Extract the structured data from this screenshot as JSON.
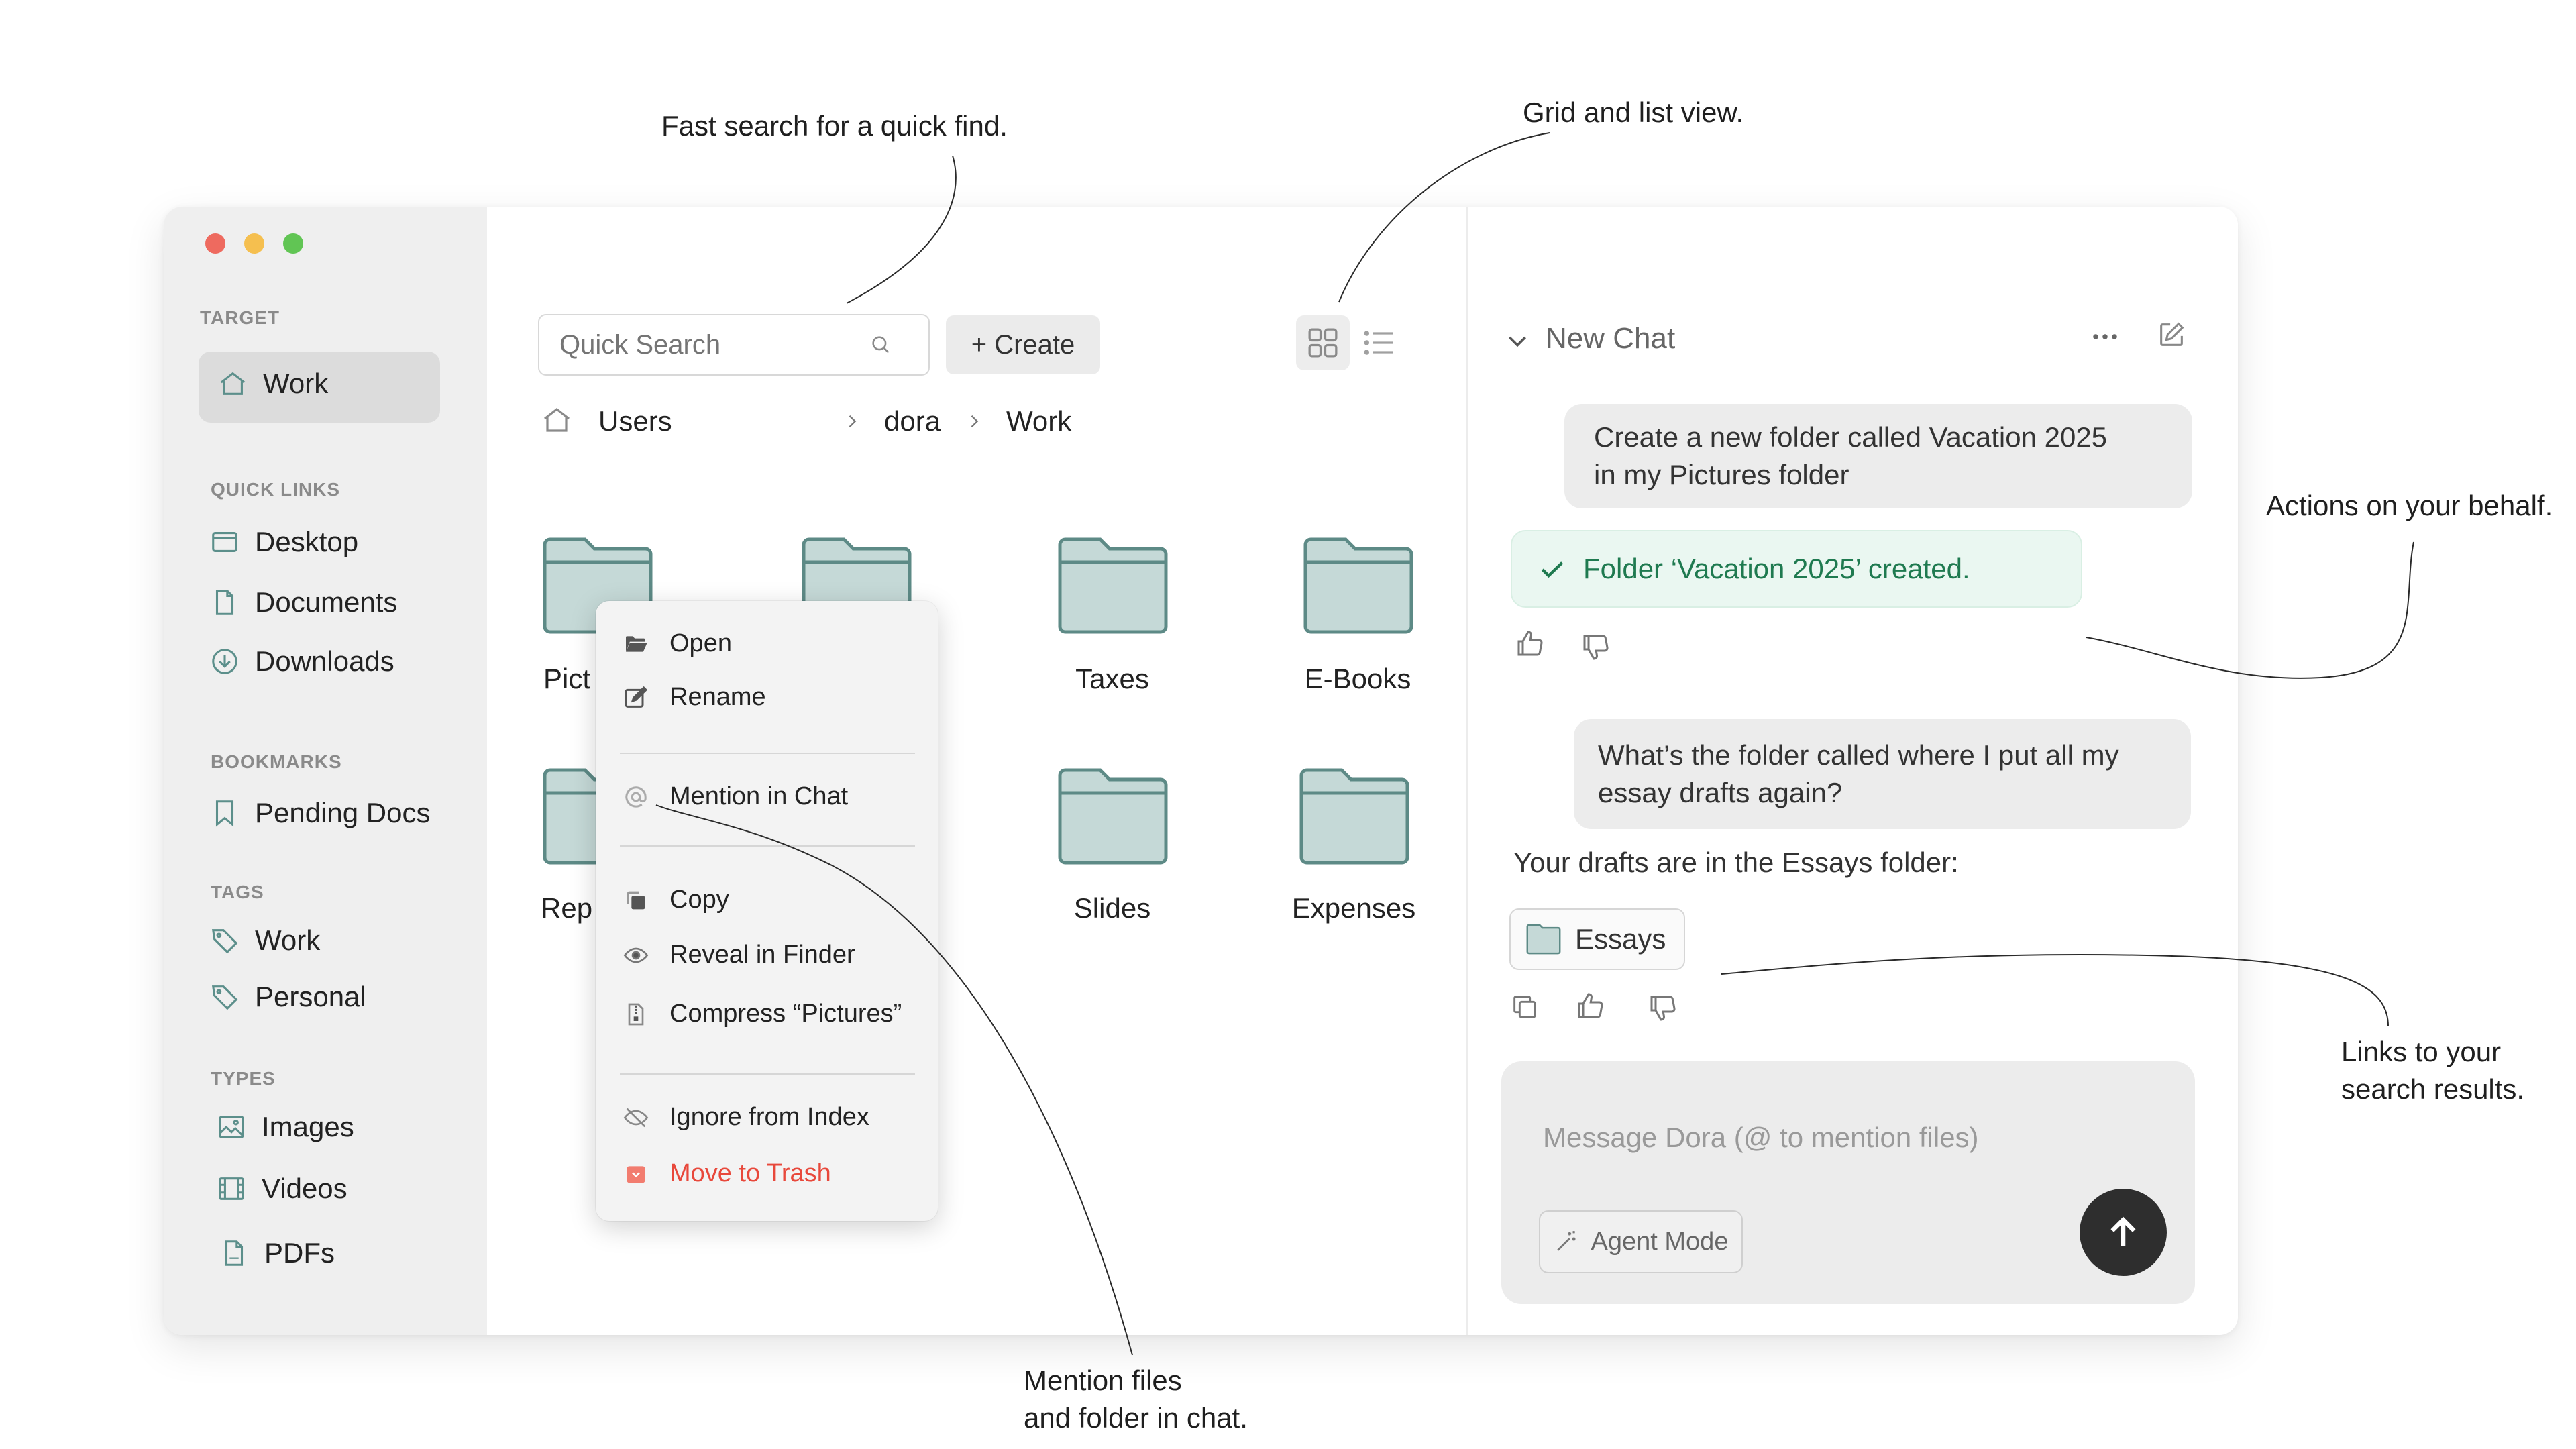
{
  "annotations": {
    "search": "Fast search for a quick find.",
    "view": "Grid and list view.",
    "actions": "Actions on your behalf.",
    "links_line1": "Links to your",
    "links_line2": "search results.",
    "mention_line1": "Mention files",
    "mention_line2": "and folder in chat."
  },
  "sidebar": {
    "target_label": "TARGET",
    "target_item": "Work",
    "quick_links_label": "QUICK LINKS",
    "quick_links": [
      "Desktop",
      "Documents",
      "Downloads"
    ],
    "bookmarks_label": "BOOKMARKS",
    "bookmarks": [
      "Pending Docs"
    ],
    "tags_label": "TAGS",
    "tags": [
      "Work",
      "Personal"
    ],
    "types_label": "TYPES",
    "types": [
      "Images",
      "Videos",
      "PDFs"
    ]
  },
  "toolbar": {
    "search_placeholder": "Quick Search",
    "create_label": "+ Create"
  },
  "breadcrumb": [
    "Users",
    "dora",
    "Work"
  ],
  "folders": [
    "Pict",
    "Taxes",
    "E-Books",
    "Rep",
    "Slides",
    "Expenses"
  ],
  "context_menu": {
    "open": "Open",
    "rename": "Rename",
    "mention": "Mention in Chat",
    "copy": "Copy",
    "reveal": "Reveal in Finder",
    "compress": "Compress “Pictures”",
    "ignore": "Ignore from Index",
    "trash": "Move to Trash"
  },
  "chat": {
    "title": "New Chat",
    "msg1_line1": "Create a new folder called Vacation 2025",
    "msg1_line2": "in my Pictures folder",
    "success": "Folder ‘Vacation 2025’ created.",
    "msg2_line1": "What’s the folder called where I put all my",
    "msg2_line2": "essay drafts again?",
    "reply": "Your drafts are in the Essays folder:",
    "chip": "Essays",
    "composer_placeholder": "Message Dora (@ to mention files)",
    "agent_mode": "Agent Mode"
  },
  "colors": {
    "folder_fill": "#c5d9d7",
    "folder_stroke": "#5d8a86",
    "success_text": "#1f7a50",
    "trash_red": "#e8483b"
  }
}
